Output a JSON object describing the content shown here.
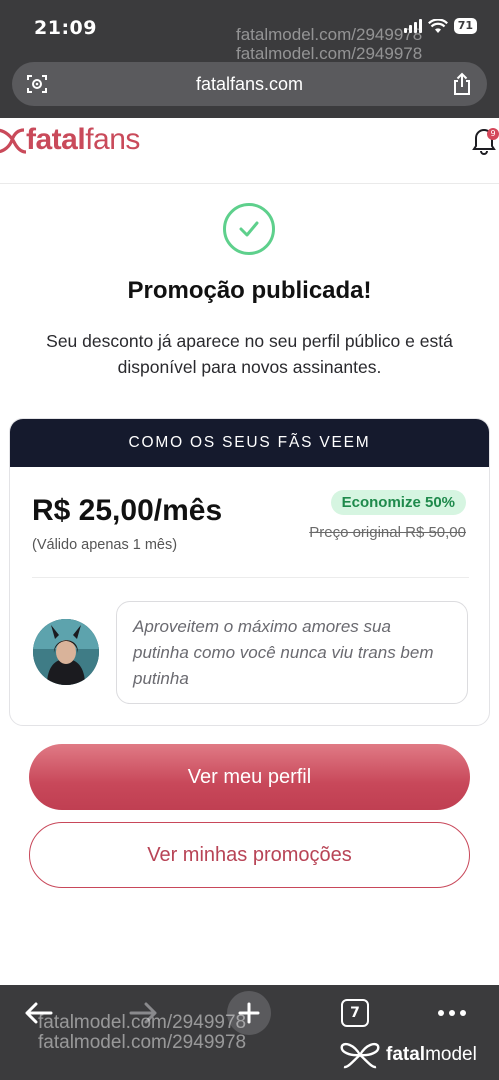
{
  "status": {
    "time": "21:09",
    "battery": "71"
  },
  "watermark": {
    "top_line1": "fatalmodel.com/2949978",
    "top_line2": "fatalmodel.com/2949978",
    "bottom_line1": "fatalmodel.com/2949978",
    "bottom_line2": "fatalmodel.com/2949978"
  },
  "browser": {
    "url": "fatalfans.com",
    "left_icon": "reader-lens-icon",
    "right_icon": "share-icon"
  },
  "site": {
    "logo_bold": "fatal",
    "logo_light": "fans",
    "notification_count": "9"
  },
  "success": {
    "title": "Promoção publicada!",
    "subtitle": "Seu desconto já aparece no seu perfil público e está disponível para novos assinantes."
  },
  "preview_card": {
    "header": "COMO OS SEUS FÃS VEEM",
    "price": "R$ 25,00/mês",
    "validity": "(Válido apenas 1 mês)",
    "discount_badge": "Economize 50%",
    "original_price": "Preço original R$ 50,00",
    "message": "Aproveitem o máximo amores sua putinha como você nunca viu trans bem putinha"
  },
  "actions": {
    "primary": "Ver meu perfil",
    "secondary": "Ver minhas promoções"
  },
  "toolbar": {
    "tab_count": "7",
    "brand_bold": "fatal",
    "brand_light": "model"
  },
  "colors": {
    "brand": "#c94a5a",
    "success": "#5ed08c",
    "card_header": "#151a2d",
    "badge_bg": "#d6f5e1",
    "badge_text": "#1f8a4c",
    "chrome": "#3b3b3d"
  }
}
